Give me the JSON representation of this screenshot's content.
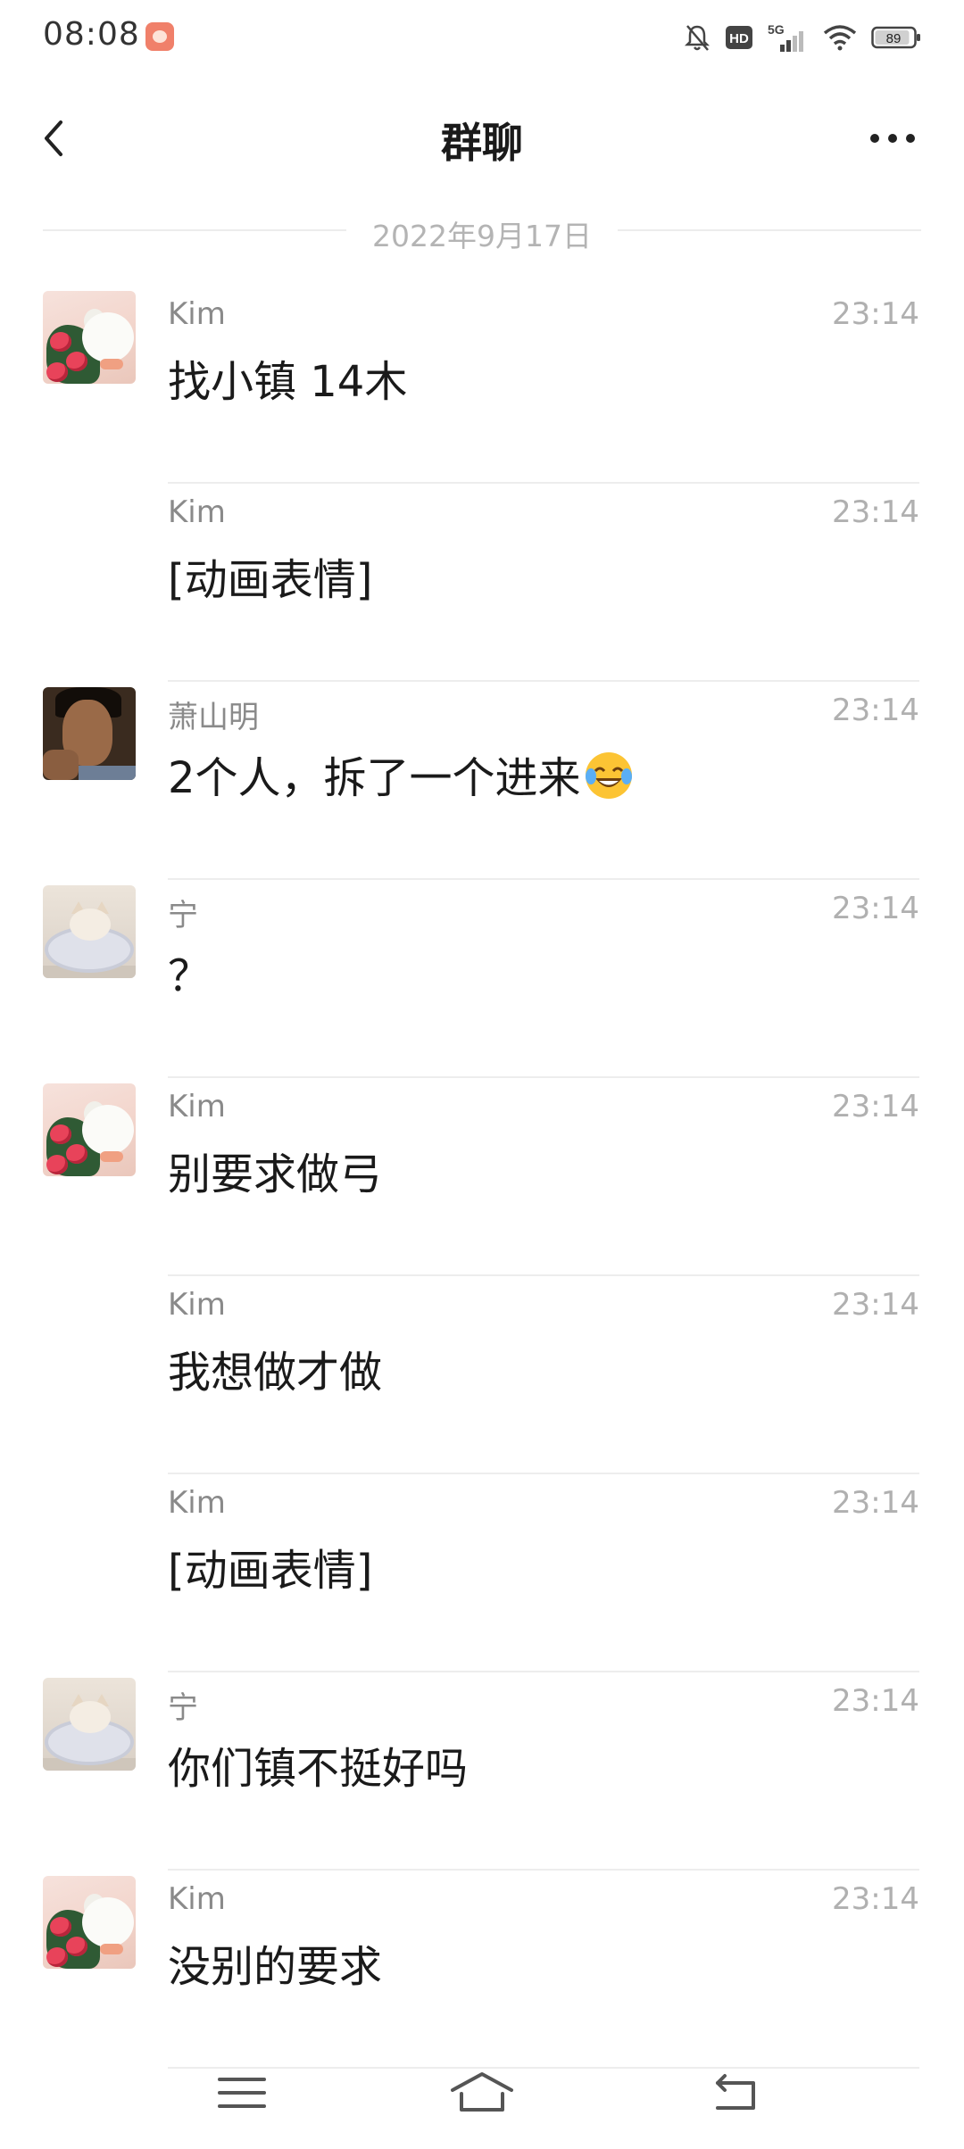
{
  "status_bar": {
    "time": "08:08",
    "icons": [
      "app-notification-icon",
      "mute-bell-icon",
      "hd-icon",
      "5g-signal-icon",
      "wifi-icon",
      "battery-icon"
    ],
    "hd_label": "HD",
    "network_label": "5G",
    "battery_level": "89"
  },
  "header": {
    "title": "群聊",
    "back_icon": "chevron-left-icon",
    "more_icon": "more-dots-icon"
  },
  "date_divider": "2022年9月17日",
  "messages": [
    {
      "sender": "Kim",
      "time": "23:14",
      "text": "找小镇 14木",
      "avatar": "kim",
      "show_avatar": true
    },
    {
      "sender": "Kim",
      "time": "23:14",
      "text": "[动画表情]",
      "avatar": "kim",
      "show_avatar": false
    },
    {
      "sender": "萧山明",
      "time": "23:14",
      "text": "2个人，拆了一个进来",
      "emoji": "laughing-crying-emoji",
      "avatar": "man",
      "show_avatar": true
    },
    {
      "sender": "宁",
      "time": "23:14",
      "text": "？",
      "avatar": "cat",
      "show_avatar": true
    },
    {
      "sender": "Kim",
      "time": "23:14",
      "text": "别要求做弓",
      "avatar": "kim",
      "show_avatar": true
    },
    {
      "sender": "Kim",
      "time": "23:14",
      "text": "我想做才做",
      "avatar": "kim",
      "show_avatar": false
    },
    {
      "sender": "Kim",
      "time": "23:14",
      "text": "[动画表情]",
      "avatar": "kim",
      "show_avatar": false
    },
    {
      "sender": "宁",
      "time": "23:14",
      "text": "你们镇不挺好吗",
      "avatar": "cat",
      "show_avatar": true
    },
    {
      "sender": "Kim",
      "time": "23:14",
      "text": "没别的要求",
      "avatar": "kim",
      "show_avatar": true
    }
  ],
  "bottom_nav": {
    "icons": [
      "menu-lines-icon",
      "home-icon",
      "back-arrow-icon"
    ]
  },
  "colors": {
    "background": "#ffffff",
    "divider": "#ededed",
    "sender": "#8a8a8a",
    "time": "#b0b0b0",
    "text": "#1a1a1a"
  }
}
